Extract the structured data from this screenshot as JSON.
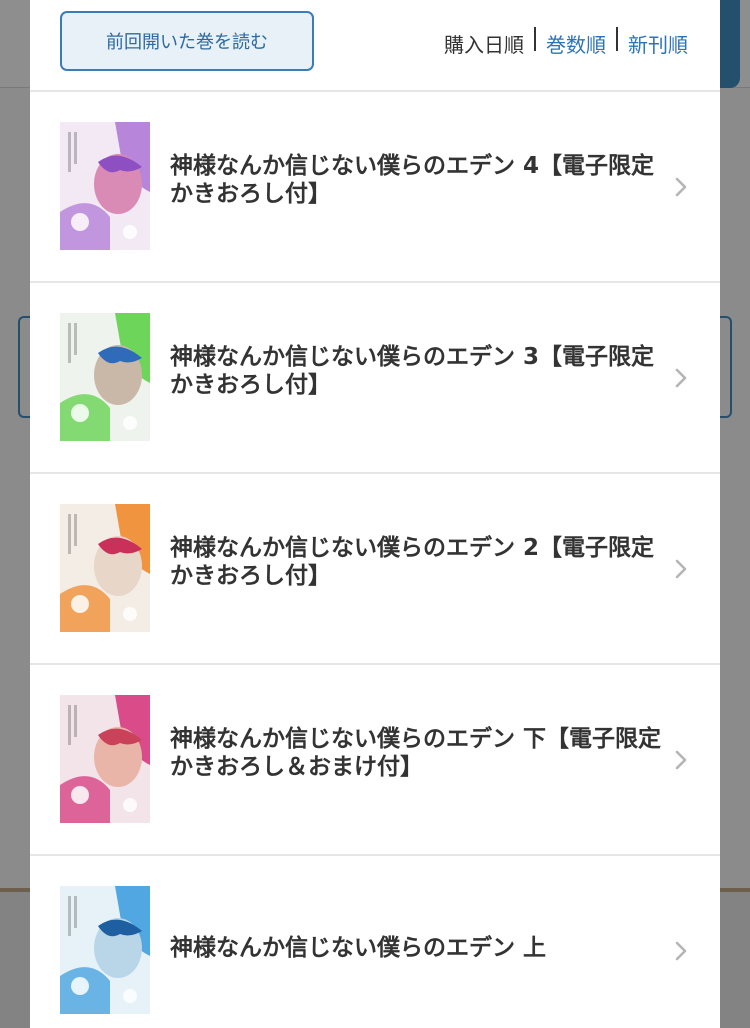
{
  "header": {
    "resume_button": "前回開いた巻を読む",
    "sort": {
      "purchase_date": "購入日順",
      "volume_order": "巻数順",
      "new_release": "新刊順"
    }
  },
  "volumes": [
    {
      "title": "神様なんか信じない僕らのエデン 4【電子限定かきおろし付】",
      "cover_colors": [
        "#f2e9f5",
        "#b07ad6",
        "#8e4fc2",
        "#d98ab5"
      ]
    },
    {
      "title": "神様なんか信じない僕らのエデン 3【電子限定かきおろし付】",
      "cover_colors": [
        "#eef3ee",
        "#5fd14a",
        "#2f6bb8",
        "#c9b8a8"
      ]
    },
    {
      "title": "神様なんか信じない僕らのエデン 2【電子限定かきおろし付】",
      "cover_colors": [
        "#f4ede6",
        "#f08a2c",
        "#c9305a",
        "#e8d6c8"
      ]
    },
    {
      "title": "神様なんか信じない僕らのエデン 下【電子限定かきおろし＆おまけ付】",
      "cover_colors": [
        "#f3e4ea",
        "#d63a7e",
        "#c9425a",
        "#e9b5a9"
      ]
    },
    {
      "title": "神様なんか信じない僕らのエデン 上",
      "cover_colors": [
        "#e7f2f8",
        "#3f9fde",
        "#1d5fa0",
        "#b9d5e8"
      ]
    }
  ],
  "icons": {
    "row_chevron": "chevron-right-icon"
  }
}
